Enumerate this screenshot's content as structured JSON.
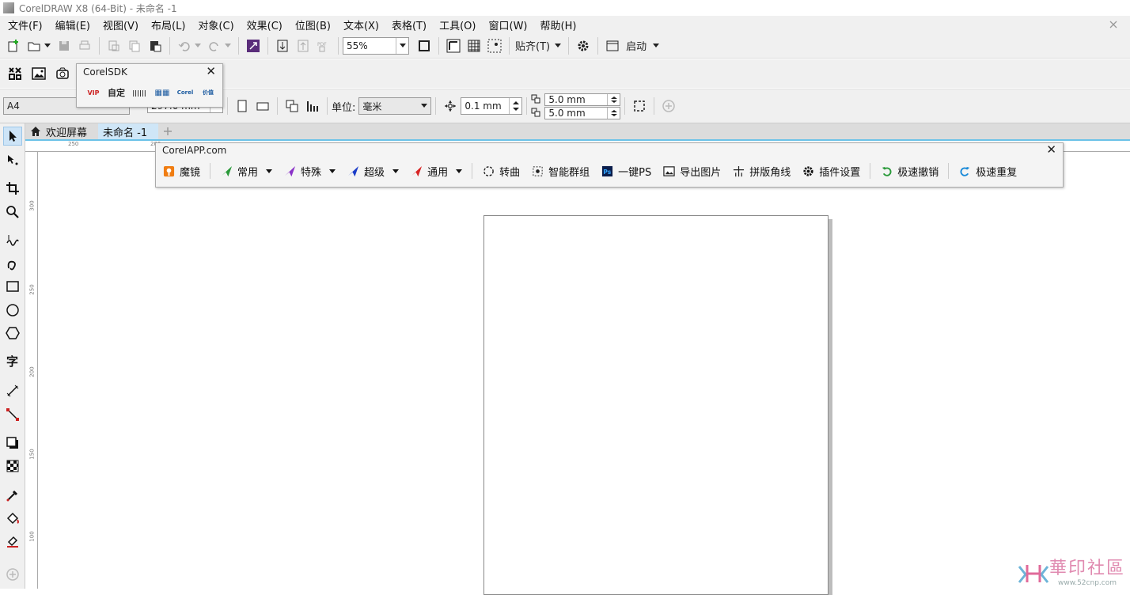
{
  "window": {
    "title": "CorelDRAW X8 (64-Bit) - 未命名 -1"
  },
  "menu": [
    "文件(F)",
    "编辑(E)",
    "视图(V)",
    "布局(L)",
    "对象(C)",
    "效果(C)",
    "位图(B)",
    "文本(X)",
    "表格(T)",
    "工具(O)",
    "窗口(W)",
    "帮助(H)"
  ],
  "toolbar": {
    "zoom": "55%",
    "snap_label": "贴齐(T)",
    "launch_label": "启动"
  },
  "properties": {
    "page_size": "A4",
    "height": "297.0 mm",
    "unit_label": "单位:",
    "unit_value": "毫米",
    "nudge": "0.1 mm",
    "dup_x": "5.0 mm",
    "dup_y": "5.0 mm"
  },
  "tabs": [
    {
      "label": "欢迎屏幕"
    },
    {
      "label": "未命名 -1"
    }
  ],
  "ruler": {
    "h_ticks": [
      "250",
      "200"
    ],
    "v_ticks": [
      "300",
      "250",
      "200",
      "150",
      "100"
    ]
  },
  "corelsdk": {
    "title": "CorelSDK",
    "icons": [
      "VIP",
      "自定",
      "||||||",
      "▦▦",
      "Corel",
      "价值"
    ]
  },
  "corelapp": {
    "title": "CorelAPP.com",
    "items": [
      "魔镜",
      "常用",
      "特殊",
      "超级",
      "通用",
      "转曲",
      "智能群组",
      "一键PS",
      "导出图片",
      "拼版角线",
      "插件设置",
      "极速撤销",
      "极速重复"
    ]
  },
  "watermark": {
    "text": "華印社區",
    "sub": "www.52cnp.com"
  },
  "colors": {
    "accent": "#1e87c8",
    "chrome": "#f0f0f0",
    "tab_active": "#cfe6f7"
  }
}
